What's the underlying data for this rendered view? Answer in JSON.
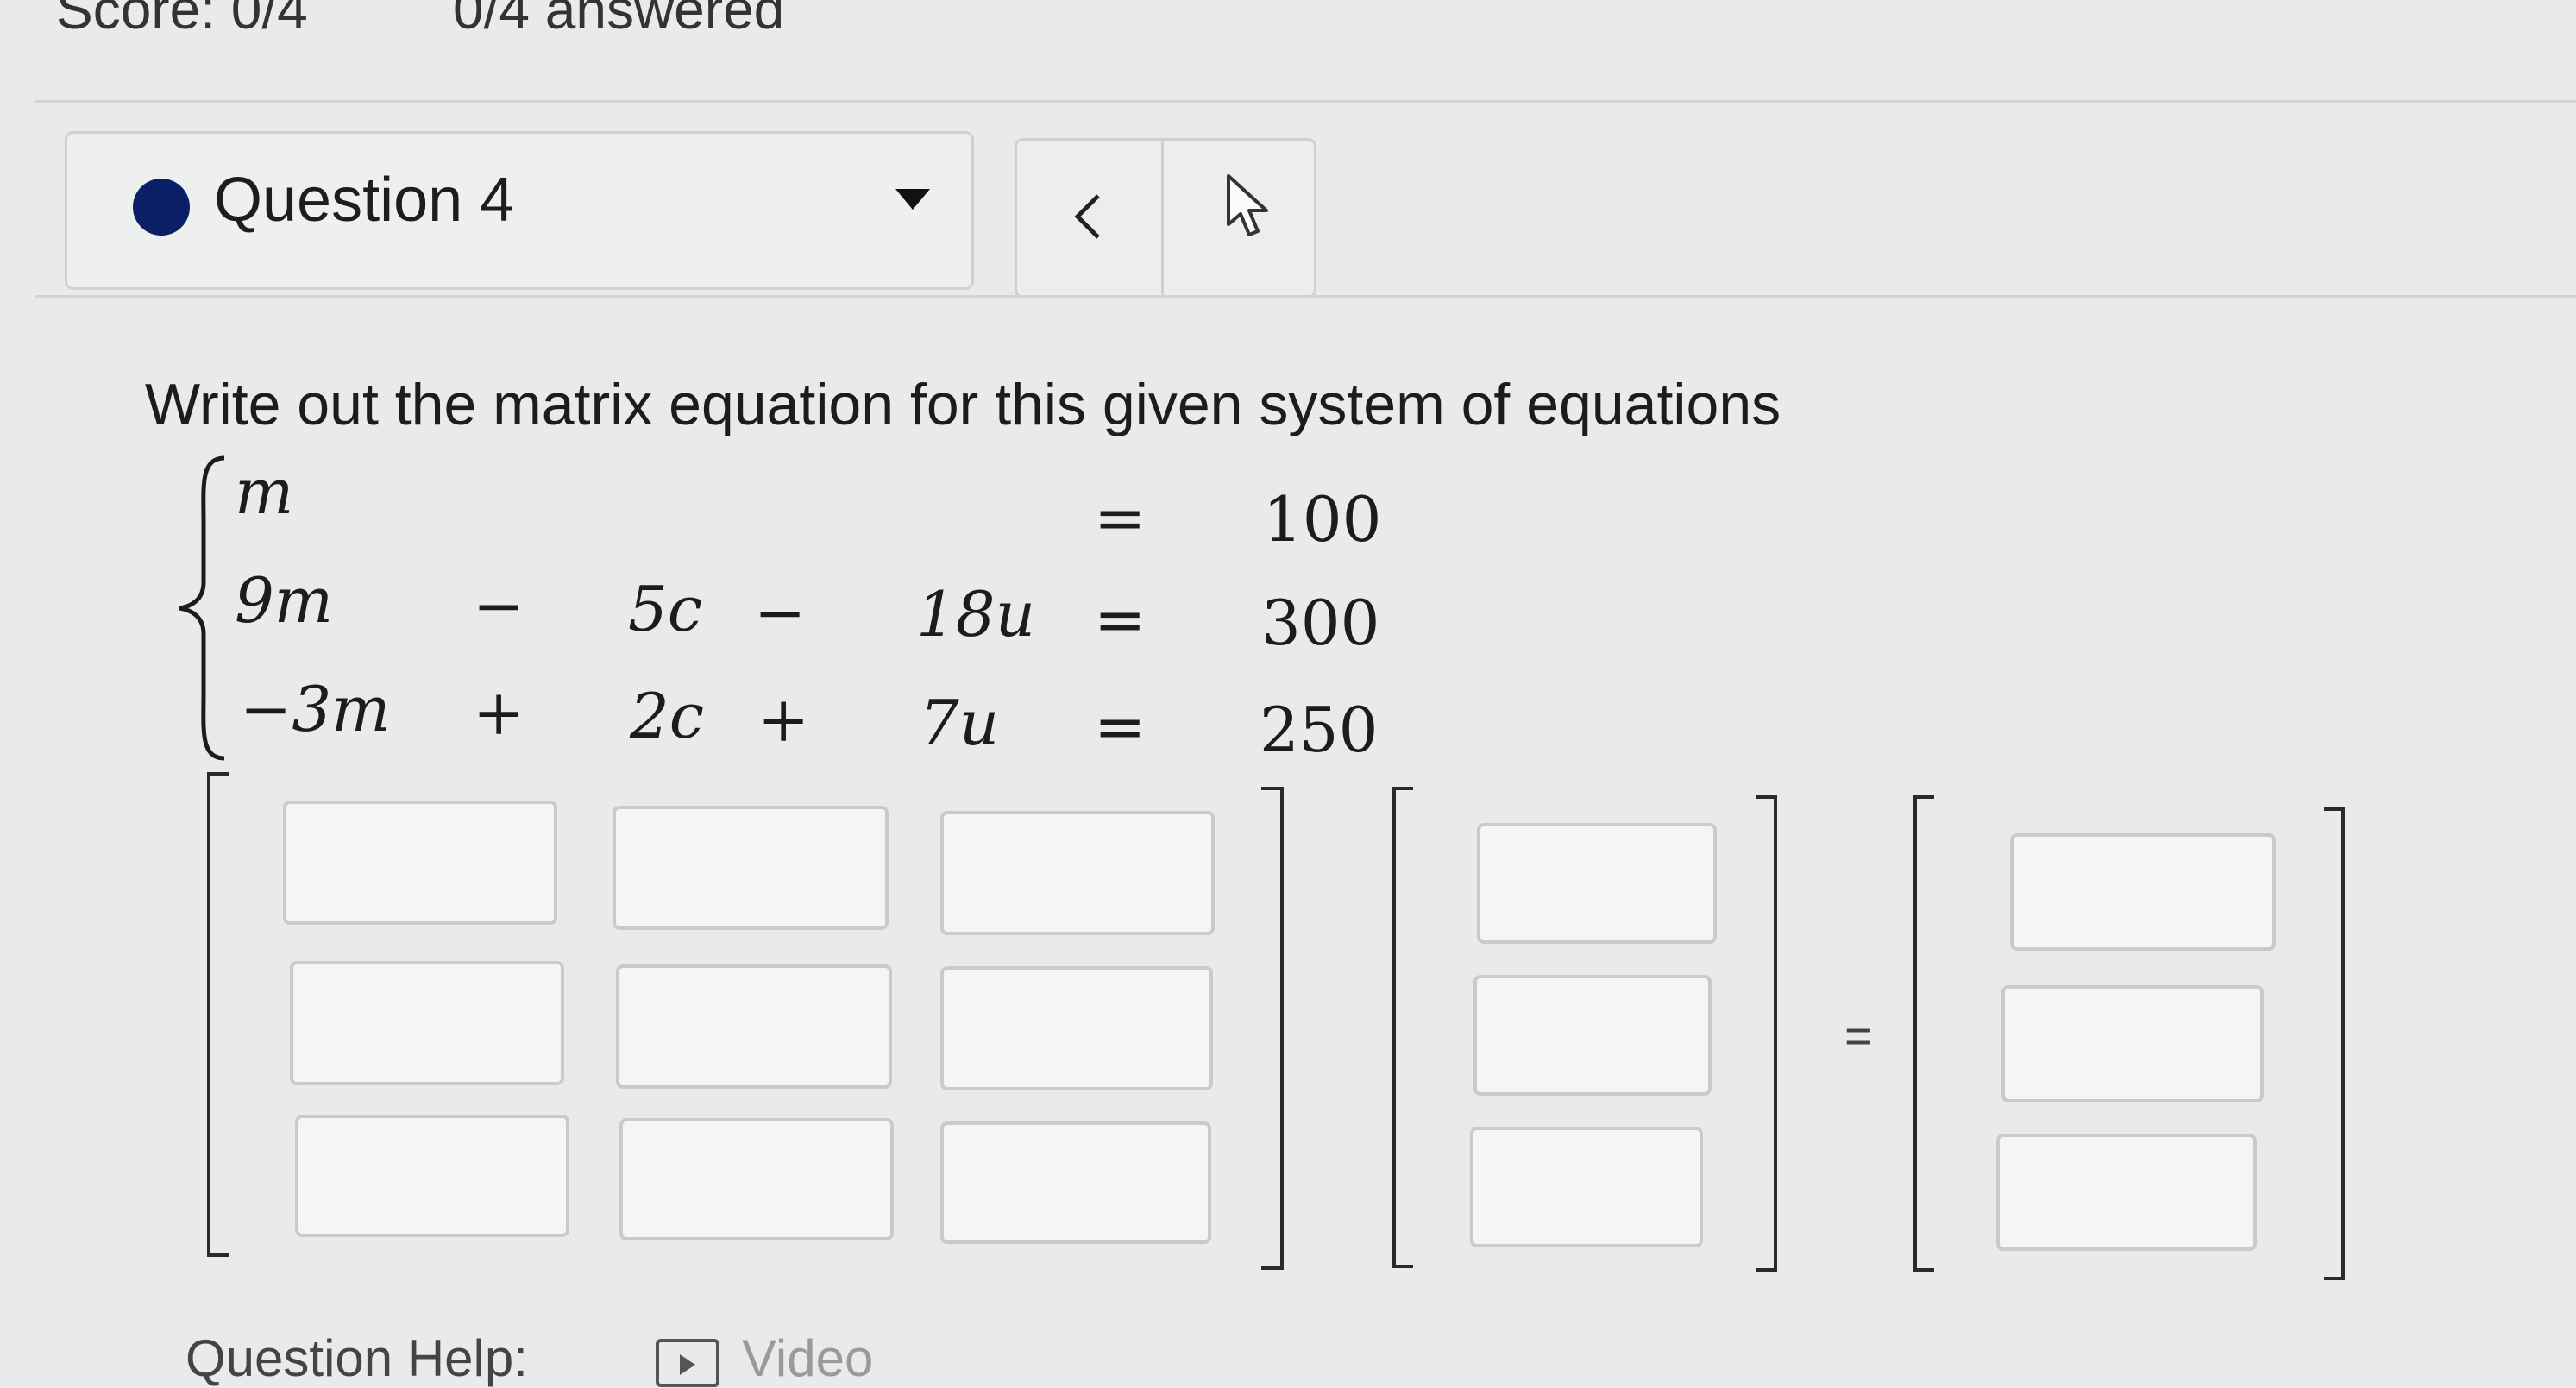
{
  "header": {
    "score": "Score: 0/4",
    "answered": "0/4 answered"
  },
  "question_select": {
    "label": "Question 4",
    "status_color": "#0b1f66",
    "dropdown_icon": "caret-down-icon"
  },
  "nav": {
    "prev_icon": "chevron-left-icon",
    "prev_label": "<",
    "next_icon": "chevron-right-icon"
  },
  "prompt": "Write out the matrix equation for this given system of equations",
  "system": {
    "rows": [
      {
        "t1": "m",
        "op1": "",
        "t2": "",
        "op2": "",
        "t3": "",
        "eq": "=",
        "rhs": "100"
      },
      {
        "t1": "9m",
        "op1": "−",
        "t2": "5c",
        "op2": "−",
        "t3": "18u",
        "eq": "=",
        "rhs": "300"
      },
      {
        "t1": "−3m",
        "op1": "+",
        "t2": "2c",
        "op2": "+",
        "t3": "7u",
        "eq": "=",
        "rhs": "250"
      }
    ]
  },
  "matrix_equation": {
    "coefficient_inputs": [
      [
        "",
        "",
        ""
      ],
      [
        "",
        "",
        ""
      ],
      [
        "",
        "",
        ""
      ]
    ],
    "variable_inputs": [
      "",
      "",
      ""
    ],
    "constant_inputs": [
      "",
      "",
      ""
    ],
    "equals": "="
  },
  "help": {
    "label": "Question Help:",
    "video_icon": "video-icon",
    "video_label": "Video"
  }
}
